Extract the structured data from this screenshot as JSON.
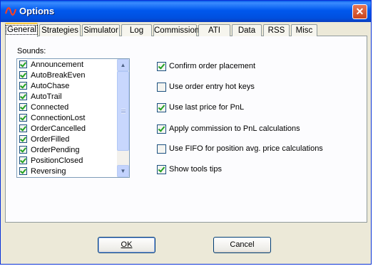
{
  "window": {
    "title": "Options",
    "close_glyph": "✕"
  },
  "tabs": [
    {
      "label": "General",
      "active": true
    },
    {
      "label": "Strategies"
    },
    {
      "label": "Simulator"
    },
    {
      "label": "Log"
    },
    {
      "label": "Commission"
    },
    {
      "label": "ATI"
    },
    {
      "label": "Data"
    },
    {
      "label": "RSS"
    },
    {
      "label": "Misc"
    }
  ],
  "sounds": {
    "label": "Sounds:",
    "items": [
      {
        "label": "Announcement",
        "checked": true
      },
      {
        "label": "AutoBreakEven",
        "checked": true
      },
      {
        "label": "AutoChase",
        "checked": true
      },
      {
        "label": "AutoTrail",
        "checked": true
      },
      {
        "label": "Connected",
        "checked": true
      },
      {
        "label": "ConnectionLost",
        "checked": true
      },
      {
        "label": "OrderCancelled",
        "checked": true
      },
      {
        "label": "OrderFilled",
        "checked": true
      },
      {
        "label": "OrderPending",
        "checked": true
      },
      {
        "label": "PositionClosed",
        "checked": true
      },
      {
        "label": "Reversing",
        "checked": true
      }
    ]
  },
  "options": [
    {
      "label": "Confirm order placement",
      "checked": true
    },
    {
      "label": "Use order entry hot keys",
      "checked": false
    },
    {
      "label": "Use last price for PnL",
      "checked": true
    },
    {
      "label": "Apply commission to PnL calculations",
      "checked": true
    },
    {
      "label": "Use FIFO for position avg. price calculations",
      "checked": false
    },
    {
      "label": "Show tools tips",
      "checked": true
    }
  ],
  "buttons": {
    "ok": "OK",
    "cancel": "Cancel"
  },
  "scrollbar": {
    "up_glyph": "▲",
    "down_glyph": "▼"
  }
}
